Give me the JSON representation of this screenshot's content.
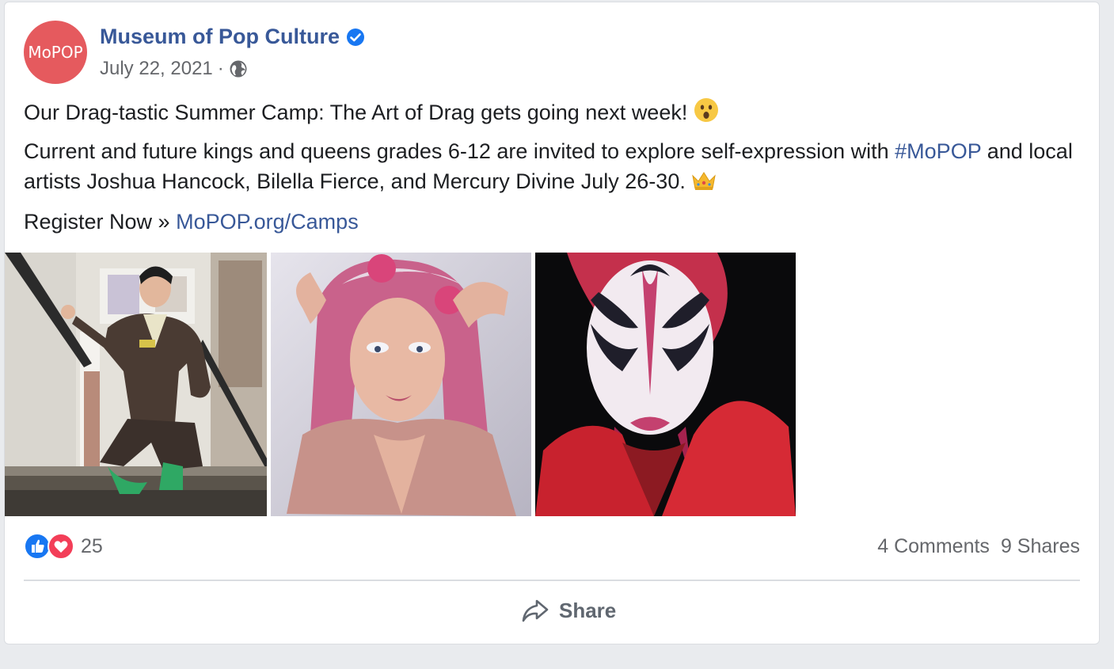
{
  "post": {
    "author": "Museum of Pop Culture",
    "avatar_text": "MoPOP",
    "date": "July 22, 2021",
    "separator": "·",
    "line1": "Our Drag-tastic Summer Camp: The Art of Drag gets going next week!",
    "line1_emoji": "😮",
    "para2_text": "Current and future kings and queens grades 6-12 are invited to explore self-expression with",
    "para2_hashtag": "#MoPOP",
    "para2_rest": "and local artists Joshua Hancock, Bilella Fierce, and Mercury Divine July 26-30.",
    "para2_emoji": "👑",
    "register_text": "Register Now »",
    "register_link": "MoPOP.org/Camps"
  },
  "engagement": {
    "reaction_count": "25",
    "comments": "4 Comments",
    "shares": "9 Shares"
  },
  "actions": {
    "share_label": "Share"
  },
  "colors": {
    "brand_link": "#385898",
    "avatar_bg": "#e55a5e",
    "like_blue": "#1877f2",
    "love_red": "#f33e58"
  },
  "icons": [
    "verified-badge-icon",
    "globe-icon",
    "like-reaction-icon",
    "love-reaction-icon",
    "share-arrow-icon"
  ]
}
